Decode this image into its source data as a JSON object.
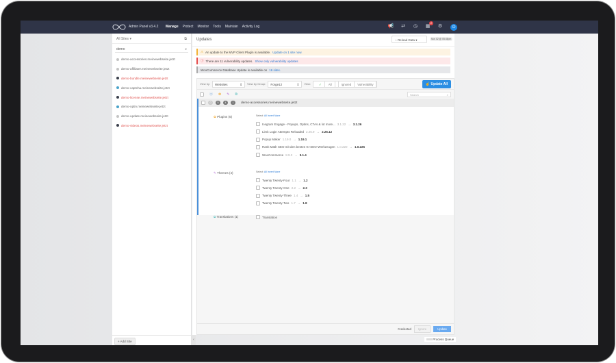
{
  "app": {
    "title": "Admin Panel v3.4.2",
    "nav": [
      "Manage",
      "Protect",
      "Monitor",
      "Tools",
      "Maintain",
      "Activity Log"
    ],
    "notification_count": "2",
    "icons": [
      "megaphone-icon",
      "sync-icon",
      "clock-icon",
      "apps-icon",
      "gear-icon",
      "power-icon"
    ]
  },
  "sidebar": {
    "header": "All Sites",
    "search_value": "demo",
    "sites": [
      {
        "name": "demo-accessories.meinewebseite.jetzt",
        "status": "gray"
      },
      {
        "name": "demo-affiliater.meinewebseite.jetzt",
        "status": "gray"
      },
      {
        "name": "demo-bundle.meinewebseite.jetzt",
        "status": "red"
      },
      {
        "name": "demo-captcha.meinewebseite.jetzt",
        "status": "blue"
      },
      {
        "name": "demo-license.meinewebseite.jetzt",
        "status": "red"
      },
      {
        "name": "demo-optin.meinewebseite.jetzt",
        "status": "blue"
      },
      {
        "name": "demo-update.meinewebseite.jetzt",
        "status": "gray"
      },
      {
        "name": "demo-videos.meinewebseite.jetzt",
        "status": "red"
      }
    ],
    "add_site": "+ Add Site"
  },
  "main": {
    "title": "Updates",
    "reload": "Reload Data",
    "timestamp": "Nov 02 @ 05:45pm",
    "alerts": {
      "warn_text": "An update to the MVP Client Plugin is available.",
      "warn_link": "Update on 1 site now.",
      "err_text": "There are 11 vulnerability updates.",
      "err_link": "Show only vulnerability updates",
      "info_text": "WooCommerce Database Update is available on",
      "info_link": "16 sites."
    },
    "toolbar": {
      "view_by_label": "View by:",
      "view_by": "Websites",
      "group_label": "View by Group:",
      "group": "Forge12",
      "view_label": "View:",
      "views": [
        "All",
        "Ignored",
        "Vulnerability"
      ],
      "update_all": "Update All",
      "search_placeholder": "Search"
    },
    "site_row": {
      "name": "demo-accessories.meinewebseite.jetzt",
      "counts": [
        "0",
        "5",
        "4",
        "1"
      ]
    },
    "select_label": "Select:",
    "select_links": [
      "All",
      "Invert",
      "None"
    ],
    "plugins": {
      "label": "Plugins (5)",
      "items": [
        {
          "name": "Icegram Engage - Popups, Optins, CTAs & lot more...",
          "old": "3.1.22",
          "new": "3.1.26"
        },
        {
          "name": "Limit Login Attempts Reloaded",
          "old": "2.26.9",
          "new": "2.26.12"
        },
        {
          "name": "Popup Maker",
          "old": "1.19.0",
          "new": "1.19.1"
        },
        {
          "name": "Rank Math SEO mit den besten KI-SEO-Werkzeugen",
          "old": "1.0.220",
          "new": "1.0.225"
        },
        {
          "name": "WooCommerce",
          "old": "8.9.2",
          "new": "9.1.4"
        }
      ]
    },
    "themes": {
      "label": "Themes (4)",
      "items": [
        {
          "name": "Twenty Twenty-Four",
          "old": "1.1",
          "new": "1.2"
        },
        {
          "name": "Twenty Twenty-One",
          "old": "2.2",
          "new": "2.3"
        },
        {
          "name": "Twenty Twenty-Three",
          "old": "1.4",
          "new": "1.5"
        },
        {
          "name": "Twenty Twenty-Two",
          "old": "1.7",
          "new": "1.8"
        }
      ]
    },
    "translations": {
      "label": "Translations (1)",
      "items": [
        {
          "name": "Translation"
        }
      ]
    },
    "footer": {
      "selected": "0 selected",
      "ignore": "Ignore",
      "update": "Update"
    }
  },
  "process_queue": "Process Queue"
}
